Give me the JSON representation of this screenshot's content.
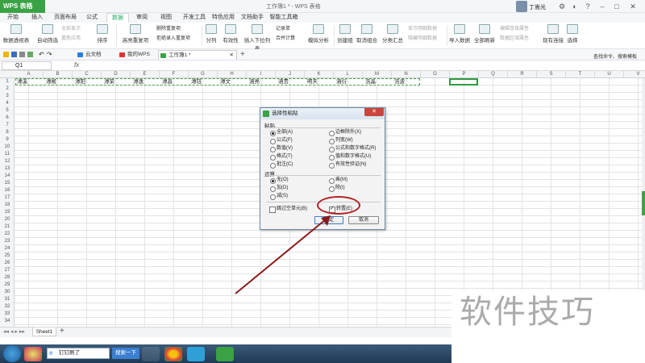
{
  "app": {
    "wps_label": "WPS 表格",
    "doc_title": "工作簿1 * - WPS 表格",
    "user_name": "丁嵩光"
  },
  "menu": {
    "tabs": [
      "开始",
      "插入",
      "页面布局",
      "公式",
      "数据",
      "审阅",
      "视图",
      "开发工具",
      "特色应用",
      "文档助手",
      "智能工具箱"
    ],
    "active": "数据"
  },
  "ribbon": {
    "pivot": "数据透视表",
    "autofilter": "自动筛选",
    "show_all": "全部显示",
    "reapply": "重新应用",
    "sort": "排序",
    "highlight_dup": "高亮重复项",
    "remove_dup": "删除重复项",
    "reject_dup": "拒绝录入重复项",
    "split": "分列",
    "validity": "有效性",
    "dropdown": "插入下拉列表",
    "record": "记录单",
    "consolidate": "合并计算",
    "simulate": "模拟分析",
    "group": "创建组",
    "ungroup": "取消组合",
    "subtotal": "分类汇总",
    "show_detail": "显示明细数据",
    "hide_detail": "隐藏明细数据",
    "import": "导入数据",
    "refresh_all": "全部刷新",
    "edit_link": "编辑连接属性",
    "range_prop": "数据区域属性",
    "existing_conn": "现有连接",
    "select": "选择"
  },
  "doc_tabs": [
    "云文档",
    "我的WPS",
    "工作簿1 *"
  ],
  "search_hint": "查找命令、搜索模板",
  "namebox": "Q1",
  "fx": "fx",
  "columns": [
    "A",
    "B",
    "C",
    "D",
    "E",
    "F",
    "G",
    "H",
    "I",
    "J",
    "K",
    "L",
    "M",
    "N",
    "O",
    "P",
    "Q",
    "R",
    "S",
    "T",
    "U",
    "V"
  ],
  "rows": [
    "1",
    "2",
    "3",
    "4",
    "5",
    "6",
    "7",
    "8",
    "9",
    "10",
    "11",
    "12",
    "13",
    "14",
    "15",
    "16",
    "17",
    "18",
    "19",
    "20",
    "21",
    "22",
    "23",
    "24",
    "25",
    "26",
    "27",
    "28",
    "29",
    "30",
    "31",
    "32",
    "33",
    "34"
  ],
  "row1_values": [
    "溥溪",
    "溥殿",
    "溥阳",
    "溥荣",
    "溥逸",
    "溥昌",
    "溥钰",
    "溥文",
    "涵亮",
    "涵贵",
    "明天",
    "涵衍",
    "浩晶",
    "浩波"
  ],
  "sheet_tab": "Sheet1",
  "dialog": {
    "title": "选择性粘贴",
    "paste_group": "粘贴",
    "paste_options": [
      "全部(A)",
      "公式(F)",
      "数值(V)",
      "格式(T)",
      "批注(C)",
      "边框除外(X)",
      "列宽(W)",
      "公式和数字格式(R)",
      "值和数字格式(U)",
      "有效性验证(N)"
    ],
    "operation_group": "运算",
    "operation_options": [
      "无(O)",
      "加(D)",
      "减(S)",
      "乘(M)",
      "除(I)"
    ],
    "skip_blanks": "跳过空单元(B)",
    "transpose": "转置(E)",
    "ok": "确定",
    "cancel": "取消"
  },
  "taskbar": {
    "search_text": "钉钉刷了",
    "search_button": "搜索一下"
  },
  "watermark": "软件技巧",
  "colors": {
    "accent": "#3aa244",
    "annotation": "#b22222"
  }
}
